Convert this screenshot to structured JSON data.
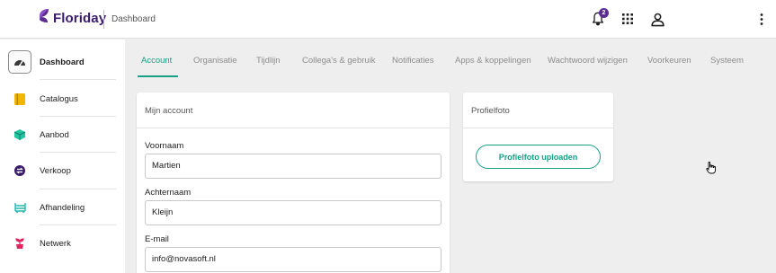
{
  "app": {
    "brand": "Floriday",
    "breadcrumb": "Dashboard",
    "notification_count": "2",
    "colors": {
      "brand": "#3b1b6b",
      "accent": "#16a085",
      "badge": "#5b2d8e"
    }
  },
  "topbar": {
    "icons": [
      "bell-icon",
      "apps-grid-icon",
      "user-icon",
      "more-vertical-icon"
    ]
  },
  "sidebar": {
    "items": [
      {
        "label": "Dashboard",
        "icon": "gauge-icon",
        "active": true
      },
      {
        "label": "Catalogus",
        "icon": "book-icon",
        "active": false
      },
      {
        "label": "Aanbod",
        "icon": "cube-icon",
        "active": false
      },
      {
        "label": "Verkoop",
        "icon": "exchange-icon",
        "active": false
      },
      {
        "label": "Afhandeling",
        "icon": "cart-icon",
        "active": false
      },
      {
        "label": "Netwerk",
        "icon": "plant-icon",
        "active": false
      }
    ]
  },
  "tabs": [
    {
      "label": "Account",
      "active": true
    },
    {
      "label": "Organisatie",
      "active": false
    },
    {
      "label": "Tijdlijn",
      "active": false
    },
    {
      "label": "Collega's & gebruik",
      "active": false
    },
    {
      "label": "Notificaties",
      "active": false
    },
    {
      "label": "Apps & koppelingen",
      "active": false
    },
    {
      "label": "Wachtwoord wijzigen",
      "active": false
    },
    {
      "label": "Voorkeuren",
      "active": false
    },
    {
      "label": "Systeem",
      "active": false
    }
  ],
  "account_card": {
    "title": "Mijn account",
    "fields": [
      {
        "label": "Voornaam",
        "value": "Martien"
      },
      {
        "label": "Achternaam",
        "value": "Kleijn"
      },
      {
        "label": "E-mail",
        "value": "info@novasoft.nl"
      }
    ]
  },
  "photo_card": {
    "title": "Profielfoto",
    "button_label": "Profielfoto uploaden"
  }
}
